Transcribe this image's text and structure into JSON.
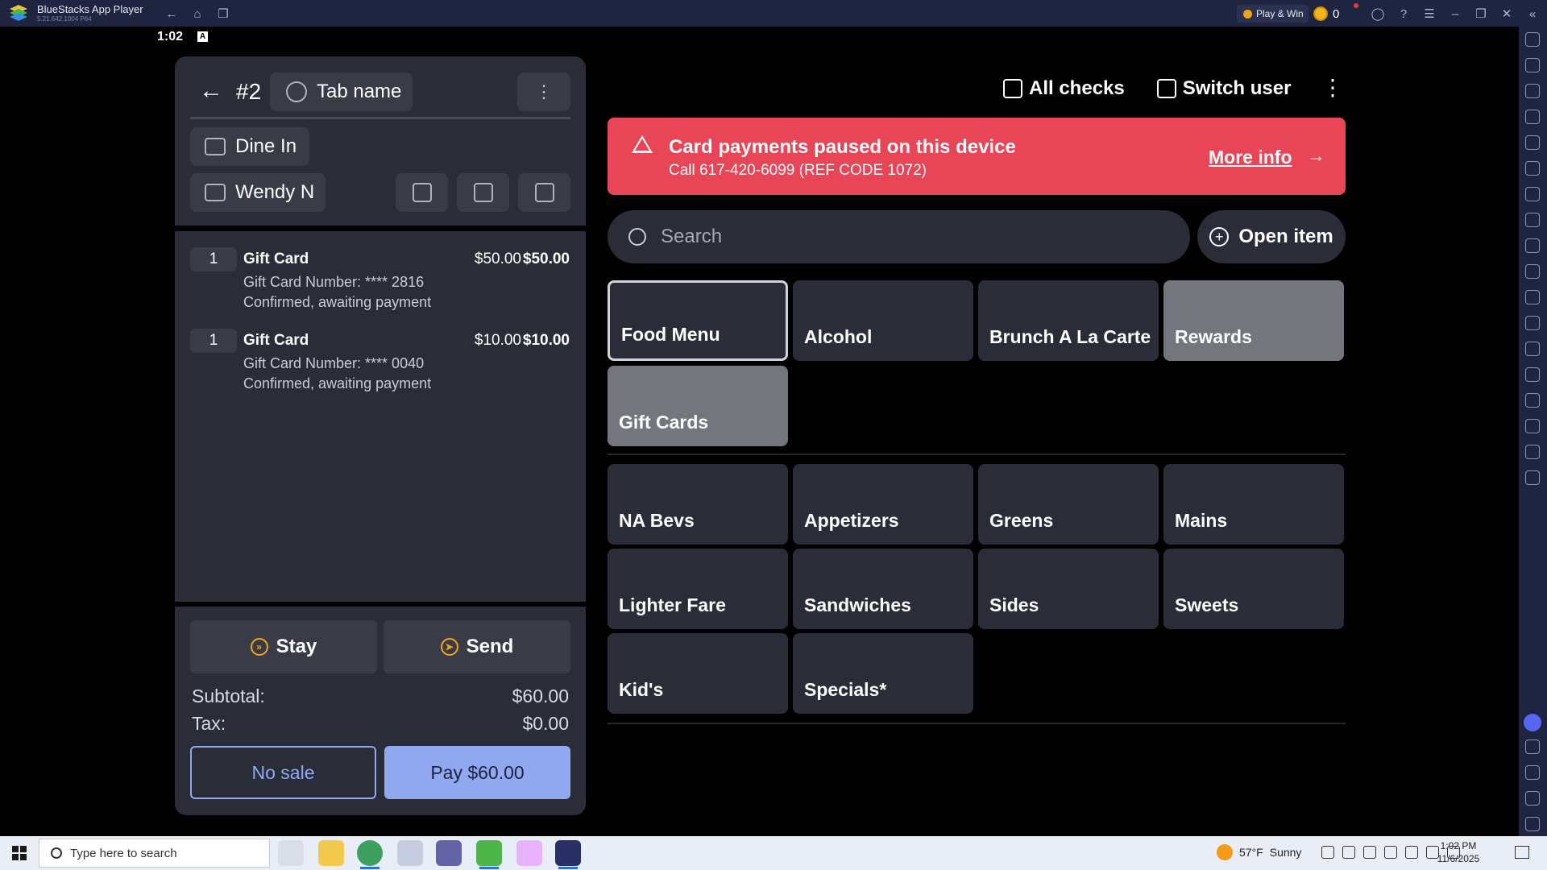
{
  "window": {
    "title": "BlueStacks App Player",
    "version": "5.21.642.1004 P64",
    "play_win": "Play & Win",
    "coins": "0"
  },
  "android": {
    "time": "1:02",
    "indicator": "A"
  },
  "order": {
    "number": "#2",
    "tab_name": "Tab name",
    "dining_option": "Dine In",
    "server": "Wendy N",
    "items": [
      {
        "qty": "1",
        "name": "Gift Card",
        "price": "$50.00",
        "total": "$50.00",
        "detail_1": "Gift Card Number: **** 2816",
        "detail_2": "Confirmed, awaiting payment"
      },
      {
        "qty": "1",
        "name": "Gift Card",
        "price": "$10.00",
        "total": "$10.00",
        "detail_1": "Gift Card Number: **** 0040",
        "detail_2": "Confirmed, awaiting payment"
      }
    ],
    "stay_label": "Stay",
    "send_label": "Send",
    "subtotal_label": "Subtotal:",
    "subtotal_value": "$60.00",
    "tax_label": "Tax:",
    "tax_value": "$0.00",
    "no_sale_label": "No sale",
    "pay_label": "Pay $60.00"
  },
  "top_actions": {
    "all_checks": "All checks",
    "switch_user": "Switch user"
  },
  "alert": {
    "title": "Card payments paused on this device",
    "subtitle": "Call 617-420-6099 (REF CODE 1072)",
    "link": "More info",
    "color": "#e84556"
  },
  "search": {
    "placeholder": "Search",
    "value": ""
  },
  "open_item_label": "Open item",
  "menus": [
    "Food Menu",
    "Alcohol",
    "Brunch A La Carte",
    "Rewards",
    "Gift Cards"
  ],
  "categories": [
    "NA Bevs",
    "Appetizers",
    "Greens",
    "Mains",
    "Lighter Fare",
    "Sandwiches",
    "Sides",
    "Sweets",
    "Kid's",
    "Specials*"
  ],
  "taskbar": {
    "search_placeholder": "Type here to search",
    "weather_temp": "57°F",
    "weather_desc": "Sunny",
    "time": "1:02 PM",
    "date": "11/6/2025"
  },
  "colors": {
    "accent": "#8fa8f0",
    "panel": "#2a2d37",
    "button": "#393c47",
    "warning_icon": "#f0a41c"
  }
}
